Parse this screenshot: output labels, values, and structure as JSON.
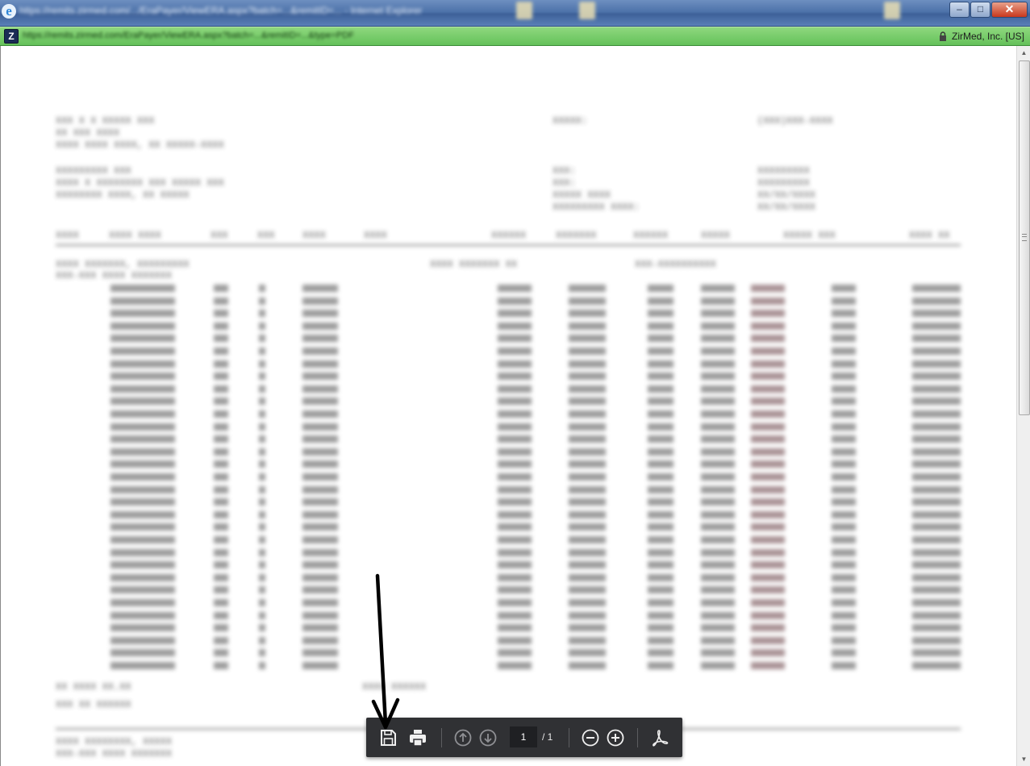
{
  "window": {
    "title": "https://remits.zirmed.com/.../EraPayer/ViewERA.aspx?batch=...&remitID=... - Internet Explorer",
    "minimize_label": "–",
    "maximize_label": "□",
    "close_label": "✕",
    "browser_icon": "ie-icon"
  },
  "address_bar": {
    "url": "https://remits.zirmed.com/EraPayer/ViewERA.aspx?batch=...&remitID=...&type=PDF",
    "site_icon": "Z",
    "certificate_label": "ZirMed, Inc. [US]",
    "lock_icon": "lock-icon"
  },
  "document": {
    "header_left": [
      "XXX X X XXXXX XXX",
      "XX XXX XXXX",
      "XXXX XXXX XXXX, XX XXXXX-XXXX"
    ],
    "provider_left": [
      "XXXXXXXXX XXX",
      "XXXX X XXXXXXXX XXX XXXXX XXX",
      "XXXXXXXX XXXX, XX XXXXX"
    ],
    "header_mid": [
      "XXXXX:",
      "",
      "",
      "XXX:",
      "XXX:",
      "XXXXX XXXX",
      "XXXXXXXXX XXXX:"
    ],
    "header_right": [
      "(XXX)XXX-XXXX",
      "",
      "",
      "XXXXXXXXX",
      "XXXXXXXXX",
      "XX/XX/XXXX",
      "XX/XX/XXXX"
    ],
    "columns": [
      "XXXX",
      "XXXX XXXX",
      "XXX",
      "XXX",
      "XXXX",
      "XXXX",
      "XXXXXX",
      "XXXXXXX",
      "XXXXXX",
      "XXXXX",
      "XXXXX XXX",
      "XXXX XX"
    ],
    "claim1_name": "XXXX XXXXXXX, XXXXXXXXX",
    "claim1_id": "XXXX XXXXXXX XX",
    "claim1_ref": "XXX-XXXXXXXXXX",
    "claim1_sub": "XXX-XXX XXXX XXXXXXX",
    "totals_label": "XX XXXX XX.XX",
    "claim_totals": "XXXX XXXXXX",
    "net_totals": "XXX XX XXXXXX",
    "claim2_name": "XXXX XXXXXXXX, XXXXX",
    "claim2_sub": "XXX-XXX XXXX XXXXXXX"
  },
  "scrollbar": {
    "up_icon": "▲",
    "down_icon": "▼"
  },
  "pdf_toolbar": {
    "save_icon": "save-icon",
    "print_icon": "print-icon",
    "prev_page_icon": "arrow-up-circle-icon",
    "next_page_icon": "arrow-down-circle-icon",
    "page_current": "1",
    "page_total": "/ 1",
    "zoom_out_icon": "zoom-out-icon",
    "zoom_in_icon": "zoom-in-icon",
    "acrobat_icon": "acrobat-icon"
  },
  "annotation": {
    "arrow_icon": "pointer-arrow-icon"
  }
}
